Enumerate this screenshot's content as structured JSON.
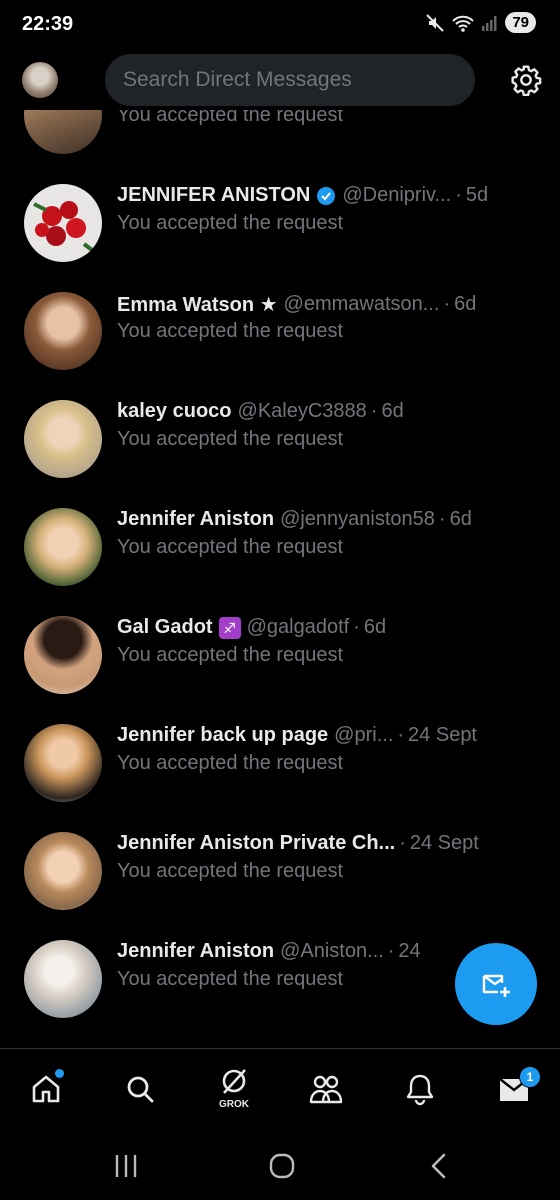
{
  "status_bar": {
    "time": "22:39",
    "battery": "79"
  },
  "search": {
    "placeholder": "Search Direct Messages"
  },
  "conversations": [
    {
      "name": "",
      "handle": "",
      "time": "",
      "preview": "You accepted the request"
    },
    {
      "name": "JENNIFER ANISTON",
      "verified": true,
      "handle": "@Denipriv...",
      "time": "5d",
      "preview": "You accepted the request"
    },
    {
      "name": "Emma Watson ★",
      "handle": "@emmawatson...",
      "time": "6d",
      "preview": "You accepted the request"
    },
    {
      "name": "kaley cuoco",
      "handle": "@KaleyC3888",
      "time": "6d",
      "preview": "You accepted the request"
    },
    {
      "name": "Jennifer Aniston",
      "handle": "@jennyaniston58",
      "time": "6d",
      "preview": "You accepted the request"
    },
    {
      "name": "Gal Gadot",
      "emoji": "♐",
      "handle": "@galgadotf",
      "time": "6d",
      "preview": "You accepted the request"
    },
    {
      "name": "Jennifer back up page",
      "handle": "@pri...",
      "time": "24 Sept",
      "preview": "You accepted the request"
    },
    {
      "name": "Jennifer Aniston Private Ch...",
      "handle": "",
      "time": "24 Sept",
      "preview": "You accepted the request"
    },
    {
      "name": "Jennifer Aniston",
      "handle": "@Aniston...",
      "time": "24",
      "preview": "You accepted the request"
    }
  ],
  "nav": {
    "grok_label": "GROK",
    "messages_badge": "1"
  },
  "colors": {
    "accent": "#1d9bf0",
    "muted": "#71767b",
    "text": "#e7e9ea"
  }
}
